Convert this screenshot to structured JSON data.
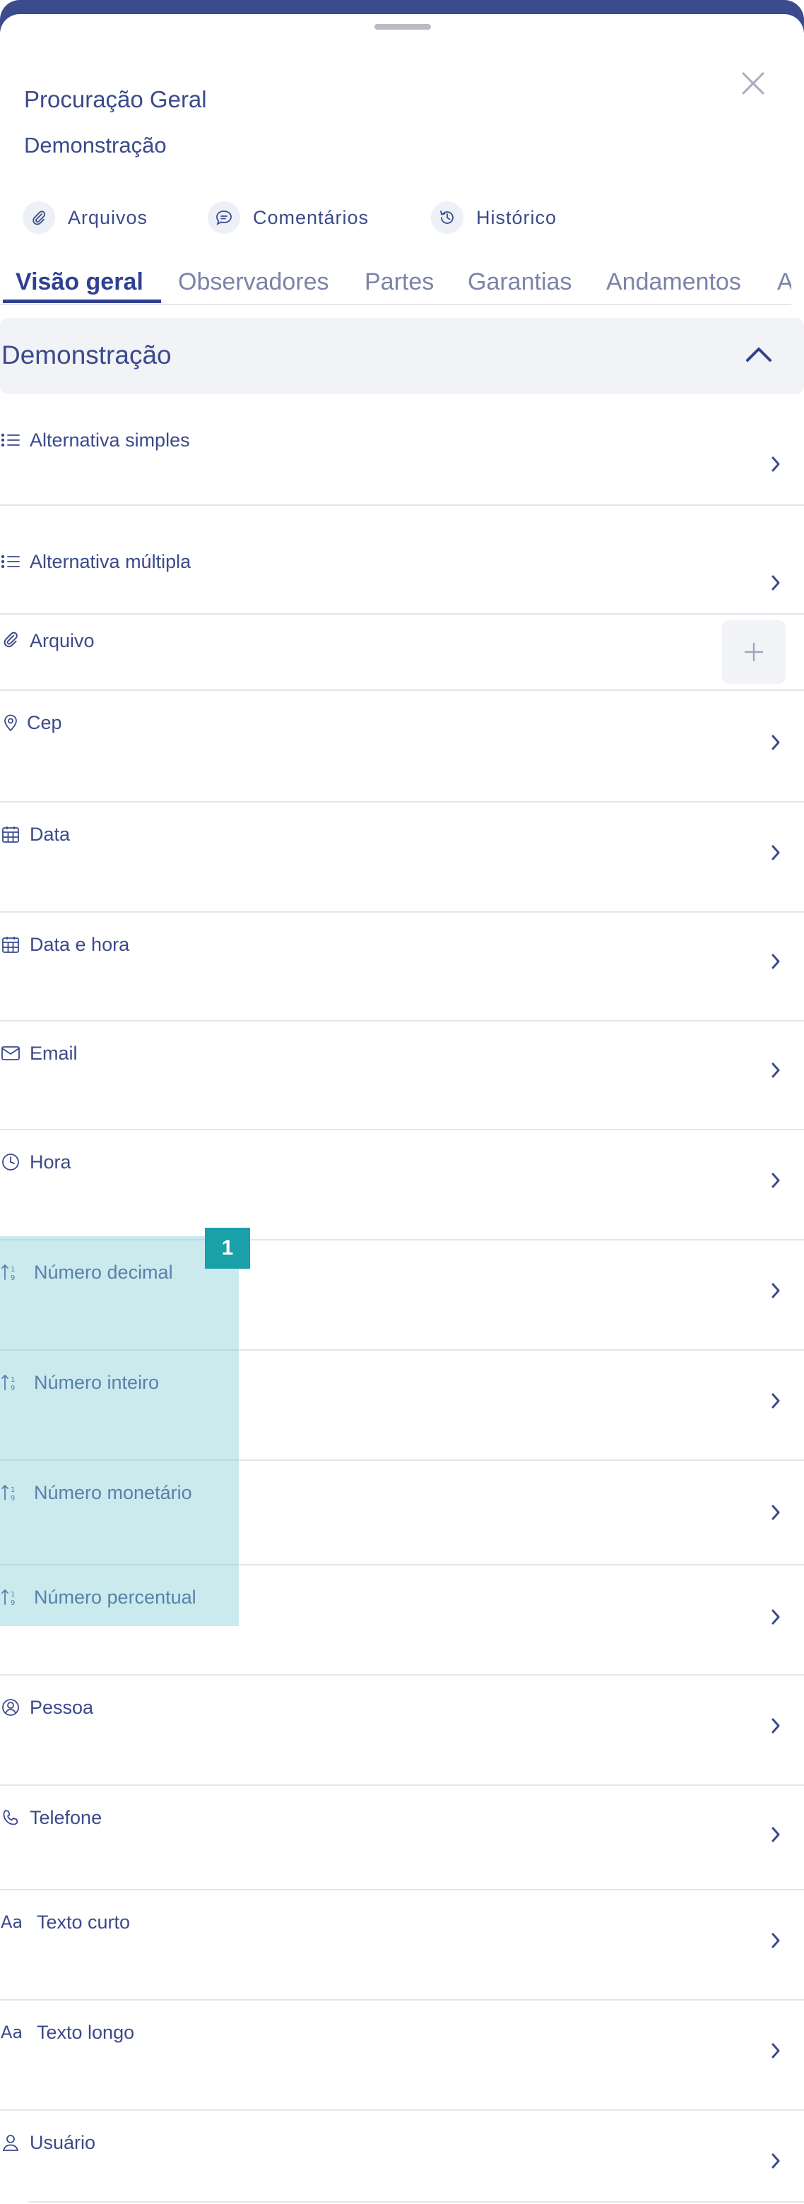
{
  "header": {
    "title": "Procuração Geral",
    "subtitle": "Demonstração",
    "close_icon": "close-icon"
  },
  "actions": [
    {
      "label": "Arquivos",
      "icon": "paperclip-icon"
    },
    {
      "label": "Comentários",
      "icon": "chat-bubble-icon"
    },
    {
      "label": "Histórico",
      "icon": "history-icon"
    }
  ],
  "tabs": [
    {
      "label": "Visão geral",
      "active": true
    },
    {
      "label": "Observadores",
      "active": false
    },
    {
      "label": "Partes",
      "active": false
    },
    {
      "label": "Garantias",
      "active": false
    },
    {
      "label": "Andamentos",
      "active": false
    },
    {
      "label": "A",
      "active": false
    }
  ],
  "section": {
    "title": "Demonstração",
    "expanded": true
  },
  "fields": [
    {
      "label": "Alternativa simples",
      "icon": "list-icon",
      "control": "chevron"
    },
    {
      "label": "Alternativa múltipla",
      "icon": "list-icon",
      "control": "chevron"
    },
    {
      "label": "Arquivo",
      "icon": "paperclip-icon",
      "control": "add"
    },
    {
      "label": "Cep",
      "icon": "map-pin-icon",
      "control": "chevron"
    },
    {
      "label": "Data",
      "icon": "calendar-icon",
      "control": "chevron"
    },
    {
      "label": "Data e hora",
      "icon": "calendar-icon",
      "control": "chevron"
    },
    {
      "label": "Email",
      "icon": "envelope-icon",
      "control": "chevron"
    },
    {
      "label": "Hora",
      "icon": "clock-icon",
      "control": "chevron"
    },
    {
      "label": "Número decimal",
      "icon": "sort-numeric-icon",
      "control": "chevron"
    },
    {
      "label": "Número inteiro",
      "icon": "sort-numeric-icon",
      "control": "chevron"
    },
    {
      "label": "Número monetário",
      "icon": "sort-numeric-icon",
      "control": "chevron"
    },
    {
      "label": "Número percentual",
      "icon": "sort-numeric-icon",
      "control": "chevron"
    },
    {
      "label": "Pessoa",
      "icon": "person-circle-icon",
      "control": "chevron"
    },
    {
      "label": "Telefone",
      "icon": "phone-icon",
      "control": "chevron"
    },
    {
      "label": "Texto curto",
      "icon": "text-icon",
      "control": "chevron"
    },
    {
      "label": "Texto longo",
      "icon": "text-icon",
      "control": "chevron"
    },
    {
      "label": "Usuário",
      "icon": "user-icon",
      "control": "chevron"
    }
  ],
  "annotation": {
    "badge": "1",
    "color": "#1aa0a8",
    "highlight_color": "#80ccd6"
  },
  "colors": {
    "primary": "#3b4a8a",
    "header_band": "#3b4b8e",
    "section_bg": "#f2f3f7",
    "tab_inactive": "#7a84a8"
  }
}
